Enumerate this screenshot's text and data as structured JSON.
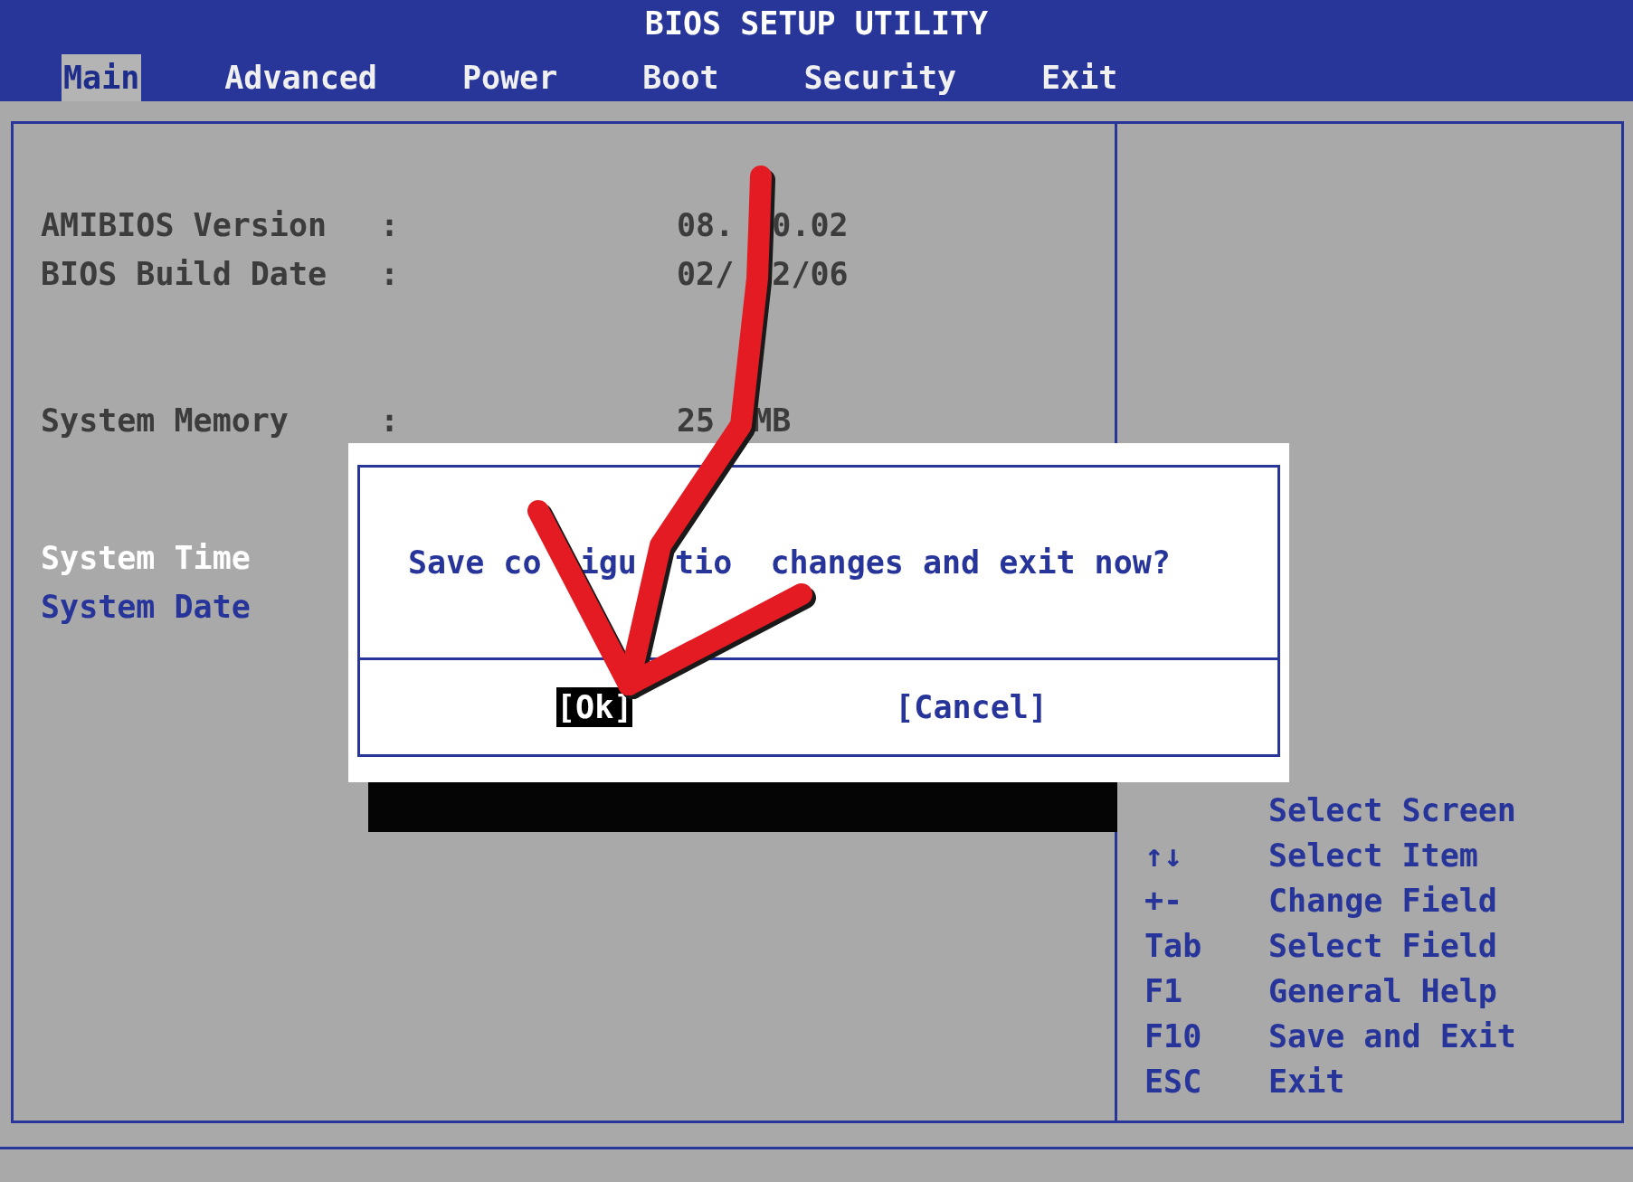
{
  "title": "BIOS SETUP UTILITY",
  "tabs": [
    {
      "label": "Main",
      "selected": true
    },
    {
      "label": "Advanced",
      "selected": false
    },
    {
      "label": "Power",
      "selected": false
    },
    {
      "label": "Boot",
      "selected": false
    },
    {
      "label": "Security",
      "selected": false
    },
    {
      "label": "Exit",
      "selected": false
    }
  ],
  "info_groups": [
    [
      {
        "label": "AMIBIOS Version",
        "separator": ":",
        "value": [
          "08.",
          "0.02"
        ]
      },
      {
        "label": "BIOS Build Date",
        "separator": ":",
        "value": [
          "02/",
          "2/06"
        ]
      }
    ],
    [
      {
        "label": "System Memory",
        "separator": ":",
        "value": [
          "25",
          "MB"
        ]
      }
    ]
  ],
  "items": [
    {
      "label": "System Time",
      "selected": true
    },
    {
      "label": "System Date",
      "selected": false
    }
  ],
  "help": [
    {
      "action": "Select Screen"
    },
    {
      "key": "↑↓",
      "action": "Select Item"
    },
    {
      "key": "+-",
      "action": "Change Field"
    },
    {
      "key": "Tab",
      "action": "Select Field"
    },
    {
      "key": "F1",
      "action": "General Help"
    },
    {
      "key": "F10",
      "action": "Save and Exit"
    },
    {
      "key": "ESC",
      "action": "Exit"
    }
  ],
  "dialog": {
    "message": [
      "Save co",
      "igu",
      "tio",
      "changes and exit now?"
    ],
    "buttons": [
      {
        "label": "[Ok]",
        "selected": true
      },
      {
        "label": "[Cancel]",
        "selected": false
      }
    ]
  }
}
